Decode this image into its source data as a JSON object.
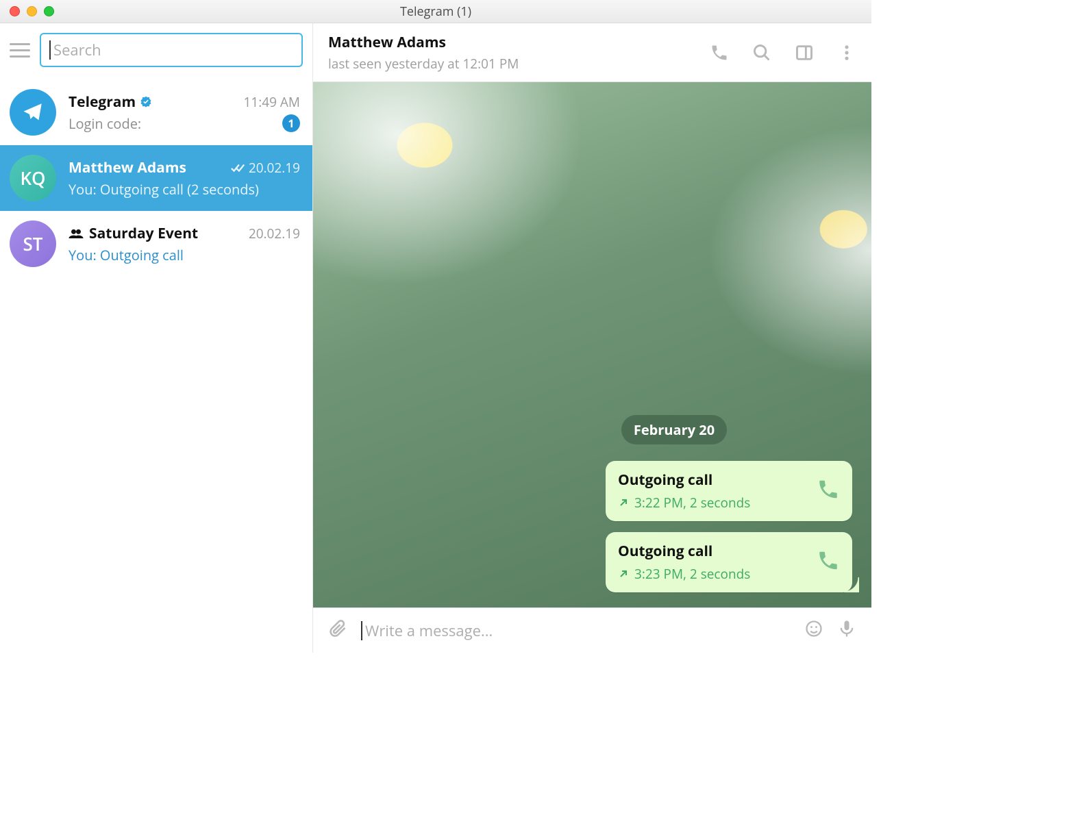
{
  "window": {
    "title": "Telegram (1)"
  },
  "search": {
    "placeholder": "Search"
  },
  "sidebar": {
    "chats": [
      {
        "name": "Telegram",
        "verified": true,
        "time": "11:49 AM",
        "preview": "Login code:",
        "unread": "1",
        "avatar": "plane"
      },
      {
        "name": "Matthew Adams",
        "time": "20.02.19",
        "read": true,
        "preview": "You: Outgoing call (2 seconds)",
        "avatar": "KQ",
        "selected": true
      },
      {
        "name": "Saturday Event",
        "time": "20.02.19",
        "group": true,
        "preview": "You: Outgoing call",
        "avatar": "ST",
        "linkish": true
      }
    ]
  },
  "header": {
    "name": "Matthew Adams",
    "status": "last seen yesterday at 12:01 PM"
  },
  "thread": {
    "date": "February 20",
    "calls": [
      {
        "title": "Outgoing call",
        "detail": "3:22 PM, 2 seconds"
      },
      {
        "title": "Outgoing call",
        "detail": "3:23 PM, 2 seconds"
      }
    ]
  },
  "composer": {
    "placeholder": "Write a message..."
  }
}
